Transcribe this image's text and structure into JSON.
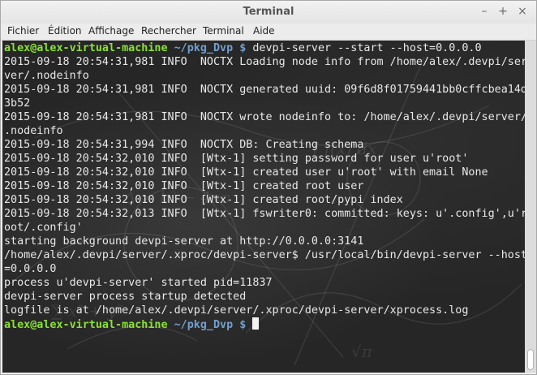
{
  "window": {
    "title": "Terminal",
    "minimize_icon": "–",
    "maximize_icon": "+",
    "close_icon": "×"
  },
  "menu": {
    "items": [
      "Fichier",
      "Édition",
      "Affichage",
      "Rechercher",
      "Terminal",
      "Aide"
    ]
  },
  "terminal": {
    "prompt_user": "alex@alex-virtual-machine",
    "prompt_path": "~/pkg_Dvp $",
    "command": " devpi-server --start --host=0.0.0.0",
    "output": [
      "2015-09-18 20:54:31,981 INFO  NOCTX Loading node info from /home/alex/.devpi/ser",
      "ver/.nodeinfo",
      "2015-09-18 20:54:31,981 INFO  NOCTX generated uuid: 09f6d8f01759441bb0cffcbea14d",
      "3b52",
      "2015-09-18 20:54:31,981 INFO  NOCTX wrote nodeinfo to: /home/alex/.devpi/server/",
      ".nodeinfo",
      "2015-09-18 20:54:31,994 INFO  NOCTX DB: Creating schema",
      "2015-09-18 20:54:32,010 INFO  [Wtx-1] setting password for user u'root'",
      "2015-09-18 20:54:32,010 INFO  [Wtx-1] created user u'root' with email None",
      "2015-09-18 20:54:32,010 INFO  [Wtx-1] created root user",
      "2015-09-18 20:54:32,010 INFO  [Wtx-1] created root/pypi index",
      "2015-09-18 20:54:32,013 INFO  [Wtx-1] fswriter0: committed: keys: u'.config',u'r",
      "oot/.config'",
      "starting background devpi-server at http://0.0.0.0:3141",
      "/home/alex/.devpi/server/.xproc/devpi-server$ /usr/local/bin/devpi-server --host",
      "=0.0.0.0",
      "process u'devpi-server' started pid=11837",
      "devpi-server process startup detected",
      "logfile is at /home/alex/.devpi/server/.xproc/devpi-server/xprocess.log"
    ],
    "final_prompt_user": "alex@alex-virtual-machine",
    "final_prompt_path": "~/pkg_Dvp $"
  },
  "colors": {
    "prompt_user": "#8ae234",
    "prompt_path": "#729fcf",
    "terminal_bg": "#262626",
    "terminal_fg": "#e8e8e8"
  }
}
